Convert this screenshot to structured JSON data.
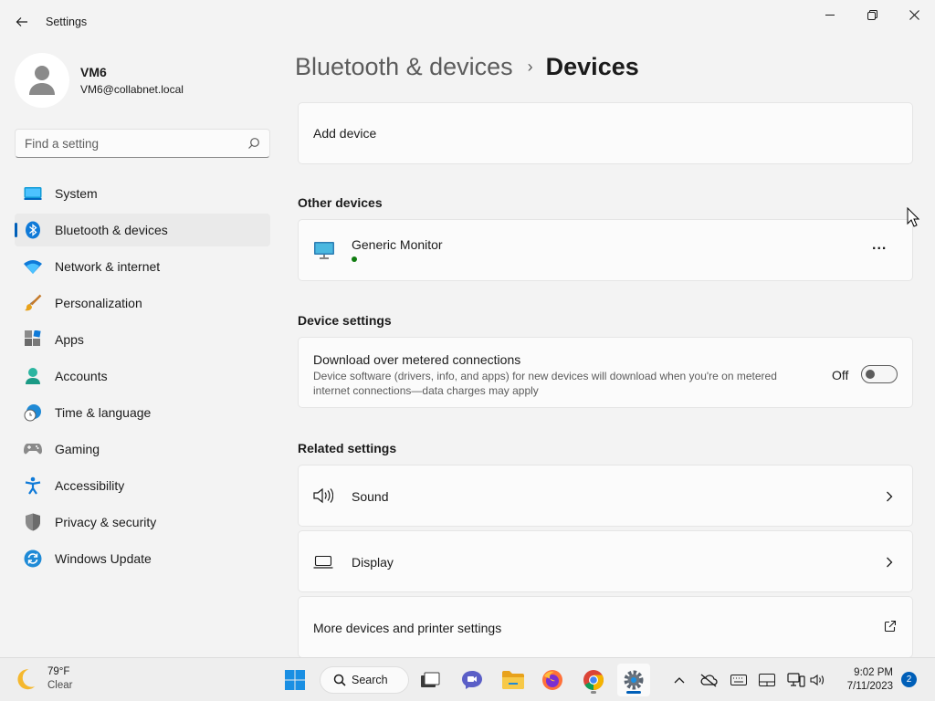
{
  "window": {
    "title": "Settings"
  },
  "user": {
    "name": "VM6",
    "email": "VM6@collabnet.local"
  },
  "search": {
    "placeholder": "Find a setting"
  },
  "sidebar": {
    "items": [
      {
        "label": "System",
        "icon": "system-icon"
      },
      {
        "label": "Bluetooth & devices",
        "icon": "bluetooth-icon",
        "active": true
      },
      {
        "label": "Network & internet",
        "icon": "wifi-icon"
      },
      {
        "label": "Personalization",
        "icon": "paintbrush-icon"
      },
      {
        "label": "Apps",
        "icon": "apps-icon"
      },
      {
        "label": "Accounts",
        "icon": "accounts-icon"
      },
      {
        "label": "Time & language",
        "icon": "globe-clock-icon"
      },
      {
        "label": "Gaming",
        "icon": "gamepad-icon"
      },
      {
        "label": "Accessibility",
        "icon": "accessibility-icon"
      },
      {
        "label": "Privacy & security",
        "icon": "shield-icon"
      },
      {
        "label": "Windows Update",
        "icon": "update-icon"
      }
    ]
  },
  "breadcrumb": {
    "parent": "Bluetooth & devices",
    "separator": "›",
    "current": "Devices"
  },
  "add_device": {
    "label": "Add device"
  },
  "other_devices": {
    "title": "Other devices",
    "devices": [
      {
        "name": "Generic Monitor",
        "status": "connected",
        "more": "..."
      }
    ]
  },
  "device_settings": {
    "title": "Device settings",
    "metered": {
      "label": "Download over metered connections",
      "description_line1": "Device software (drivers, info, and apps) for new devices will download when you're on metered",
      "description_line2": "internet connections—data charges may apply",
      "state_label": "Off",
      "enabled": false
    }
  },
  "related_settings": {
    "title": "Related settings",
    "items": [
      {
        "label": "Sound",
        "icon": "speaker-icon",
        "action": "chevron-right-icon"
      },
      {
        "label": "Display",
        "icon": "laptop-icon",
        "action": "chevron-right-icon"
      },
      {
        "label": "More devices and printer settings",
        "action": "open-external-icon"
      }
    ]
  },
  "taskbar": {
    "weather": {
      "temp": "79°F",
      "condition": "Clear"
    },
    "search_label": "Search",
    "time": "9:02 PM",
    "date": "7/11/2023",
    "notification_count": "2"
  },
  "colors": {
    "accent": "#005fb8",
    "online": "#107c10"
  }
}
